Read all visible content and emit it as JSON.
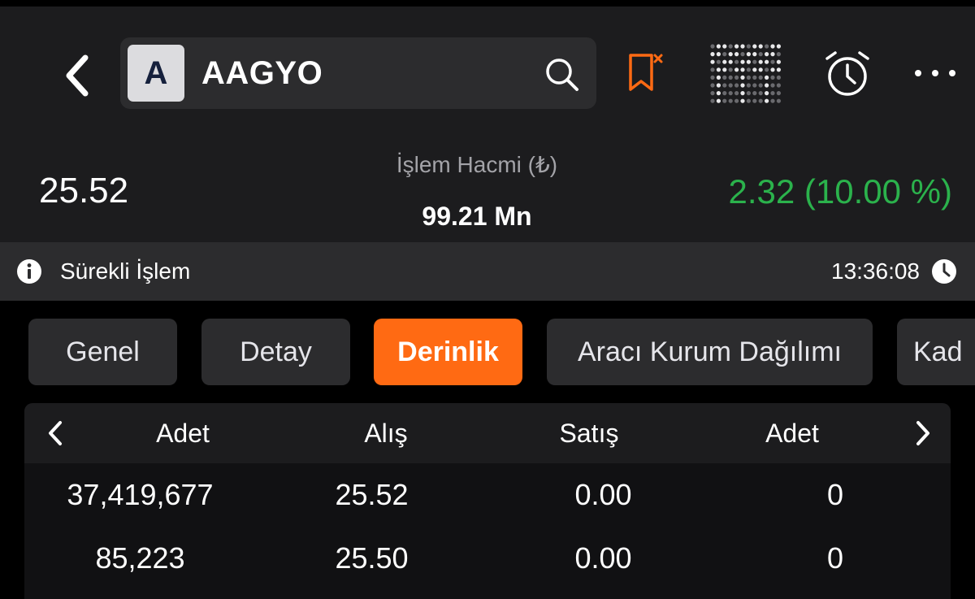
{
  "header": {
    "back_icon": "chevron-left-icon",
    "avatar_letter": "A",
    "symbol": "AAGYO",
    "icons": [
      "search-icon",
      "bookmark-remove-icon",
      "market-depth-grid-icon",
      "alarm-clock-icon",
      "more-icon"
    ]
  },
  "quote": {
    "price": "25.52",
    "volume_label": "İşlem Hacmi (₺)",
    "volume_value": "99.21 Mn",
    "change": "2.32 (10.00 %)",
    "change_color": "#2bb24c"
  },
  "status": {
    "label": "Sürekli İşlem",
    "time": "13:36:08"
  },
  "tabs": [
    {
      "label": "Genel",
      "active": false
    },
    {
      "label": "Detay",
      "active": false
    },
    {
      "label": "Derinlik",
      "active": true
    },
    {
      "label": "Aracı Kurum Dağılımı",
      "active": false
    },
    {
      "label": "Kad",
      "active": false
    }
  ],
  "accent_color": "#ff6a13",
  "depth_table": {
    "columns": [
      "Adet",
      "Alış",
      "Satış",
      "Adet"
    ],
    "rows": [
      [
        "37,419,677",
        "25.52",
        "0.00",
        "0"
      ],
      [
        "85,223",
        "25.50",
        "0.00",
        "0"
      ]
    ]
  }
}
